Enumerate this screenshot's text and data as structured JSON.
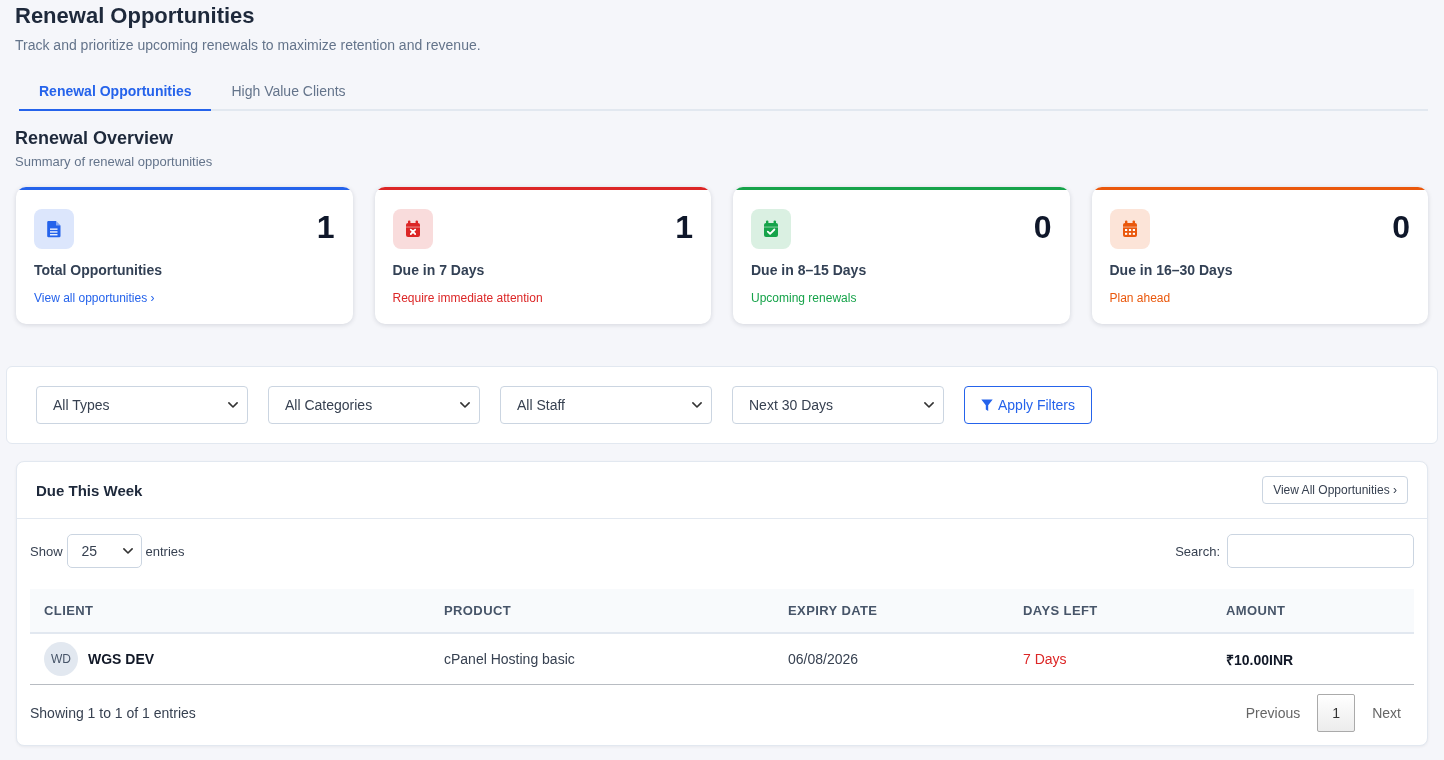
{
  "header": {
    "title": "Renewal Opportunities",
    "subtitle": "Track and prioritize upcoming renewals to maximize retention and revenue."
  },
  "tabs": [
    {
      "label": "Renewal Opportunities",
      "selected": true
    },
    {
      "label": "High Value Clients",
      "selected": false
    }
  ],
  "overview": {
    "title": "Renewal Overview",
    "subtitle": "Summary of renewal opportunities",
    "cards": [
      {
        "kind": "document",
        "color": "#2563eb",
        "count": "1",
        "label": "Total Opportunities",
        "note": "View all opportunities",
        "link_arrow": "›"
      },
      {
        "kind": "calendar-x",
        "color": "#dc2626",
        "count": "1",
        "label": "Due in 7 Days",
        "note": "Require immediate attention"
      },
      {
        "kind": "calendar-check",
        "color": "#16a34a",
        "count": "0",
        "label": "Due in 8–15 Days",
        "note": "Upcoming renewals"
      },
      {
        "kind": "calendar",
        "color": "#ea580c",
        "count": "0",
        "label": "Due in 16–30 Days",
        "note": "Plan ahead"
      }
    ]
  },
  "filters": {
    "selects": [
      {
        "value": "All Types"
      },
      {
        "value": "All Categories"
      },
      {
        "value": "All Staff"
      },
      {
        "value": "Next 30 Days"
      }
    ],
    "apply_button": "Apply Filters"
  },
  "due_this_week": {
    "title": "Due This Week",
    "view_all_button": "View All Opportunities ›",
    "length_menu": {
      "prefix": "Show",
      "value": "25",
      "suffix": "entries"
    },
    "search": {
      "label": "Search:"
    },
    "columns": [
      "CLIENT",
      "PRODUCT",
      "EXPIRY DATE",
      "DAYS LEFT",
      "AMOUNT"
    ],
    "rows": [
      {
        "initials": "WD",
        "client": "WGS DEV",
        "product": "cPanel Hosting basic",
        "expiry_date": "06/08/2026",
        "days_left": "7 Days",
        "urgent": true,
        "amount": "₹10.00INR"
      }
    ],
    "info": "Showing 1 to 1 of 1 entries",
    "pagination": {
      "previous": {
        "label": "Previous",
        "disabled": true
      },
      "pages": [
        {
          "label": "1",
          "selected": true
        }
      ],
      "next": {
        "label": "Next",
        "disabled": true
      }
    }
  }
}
